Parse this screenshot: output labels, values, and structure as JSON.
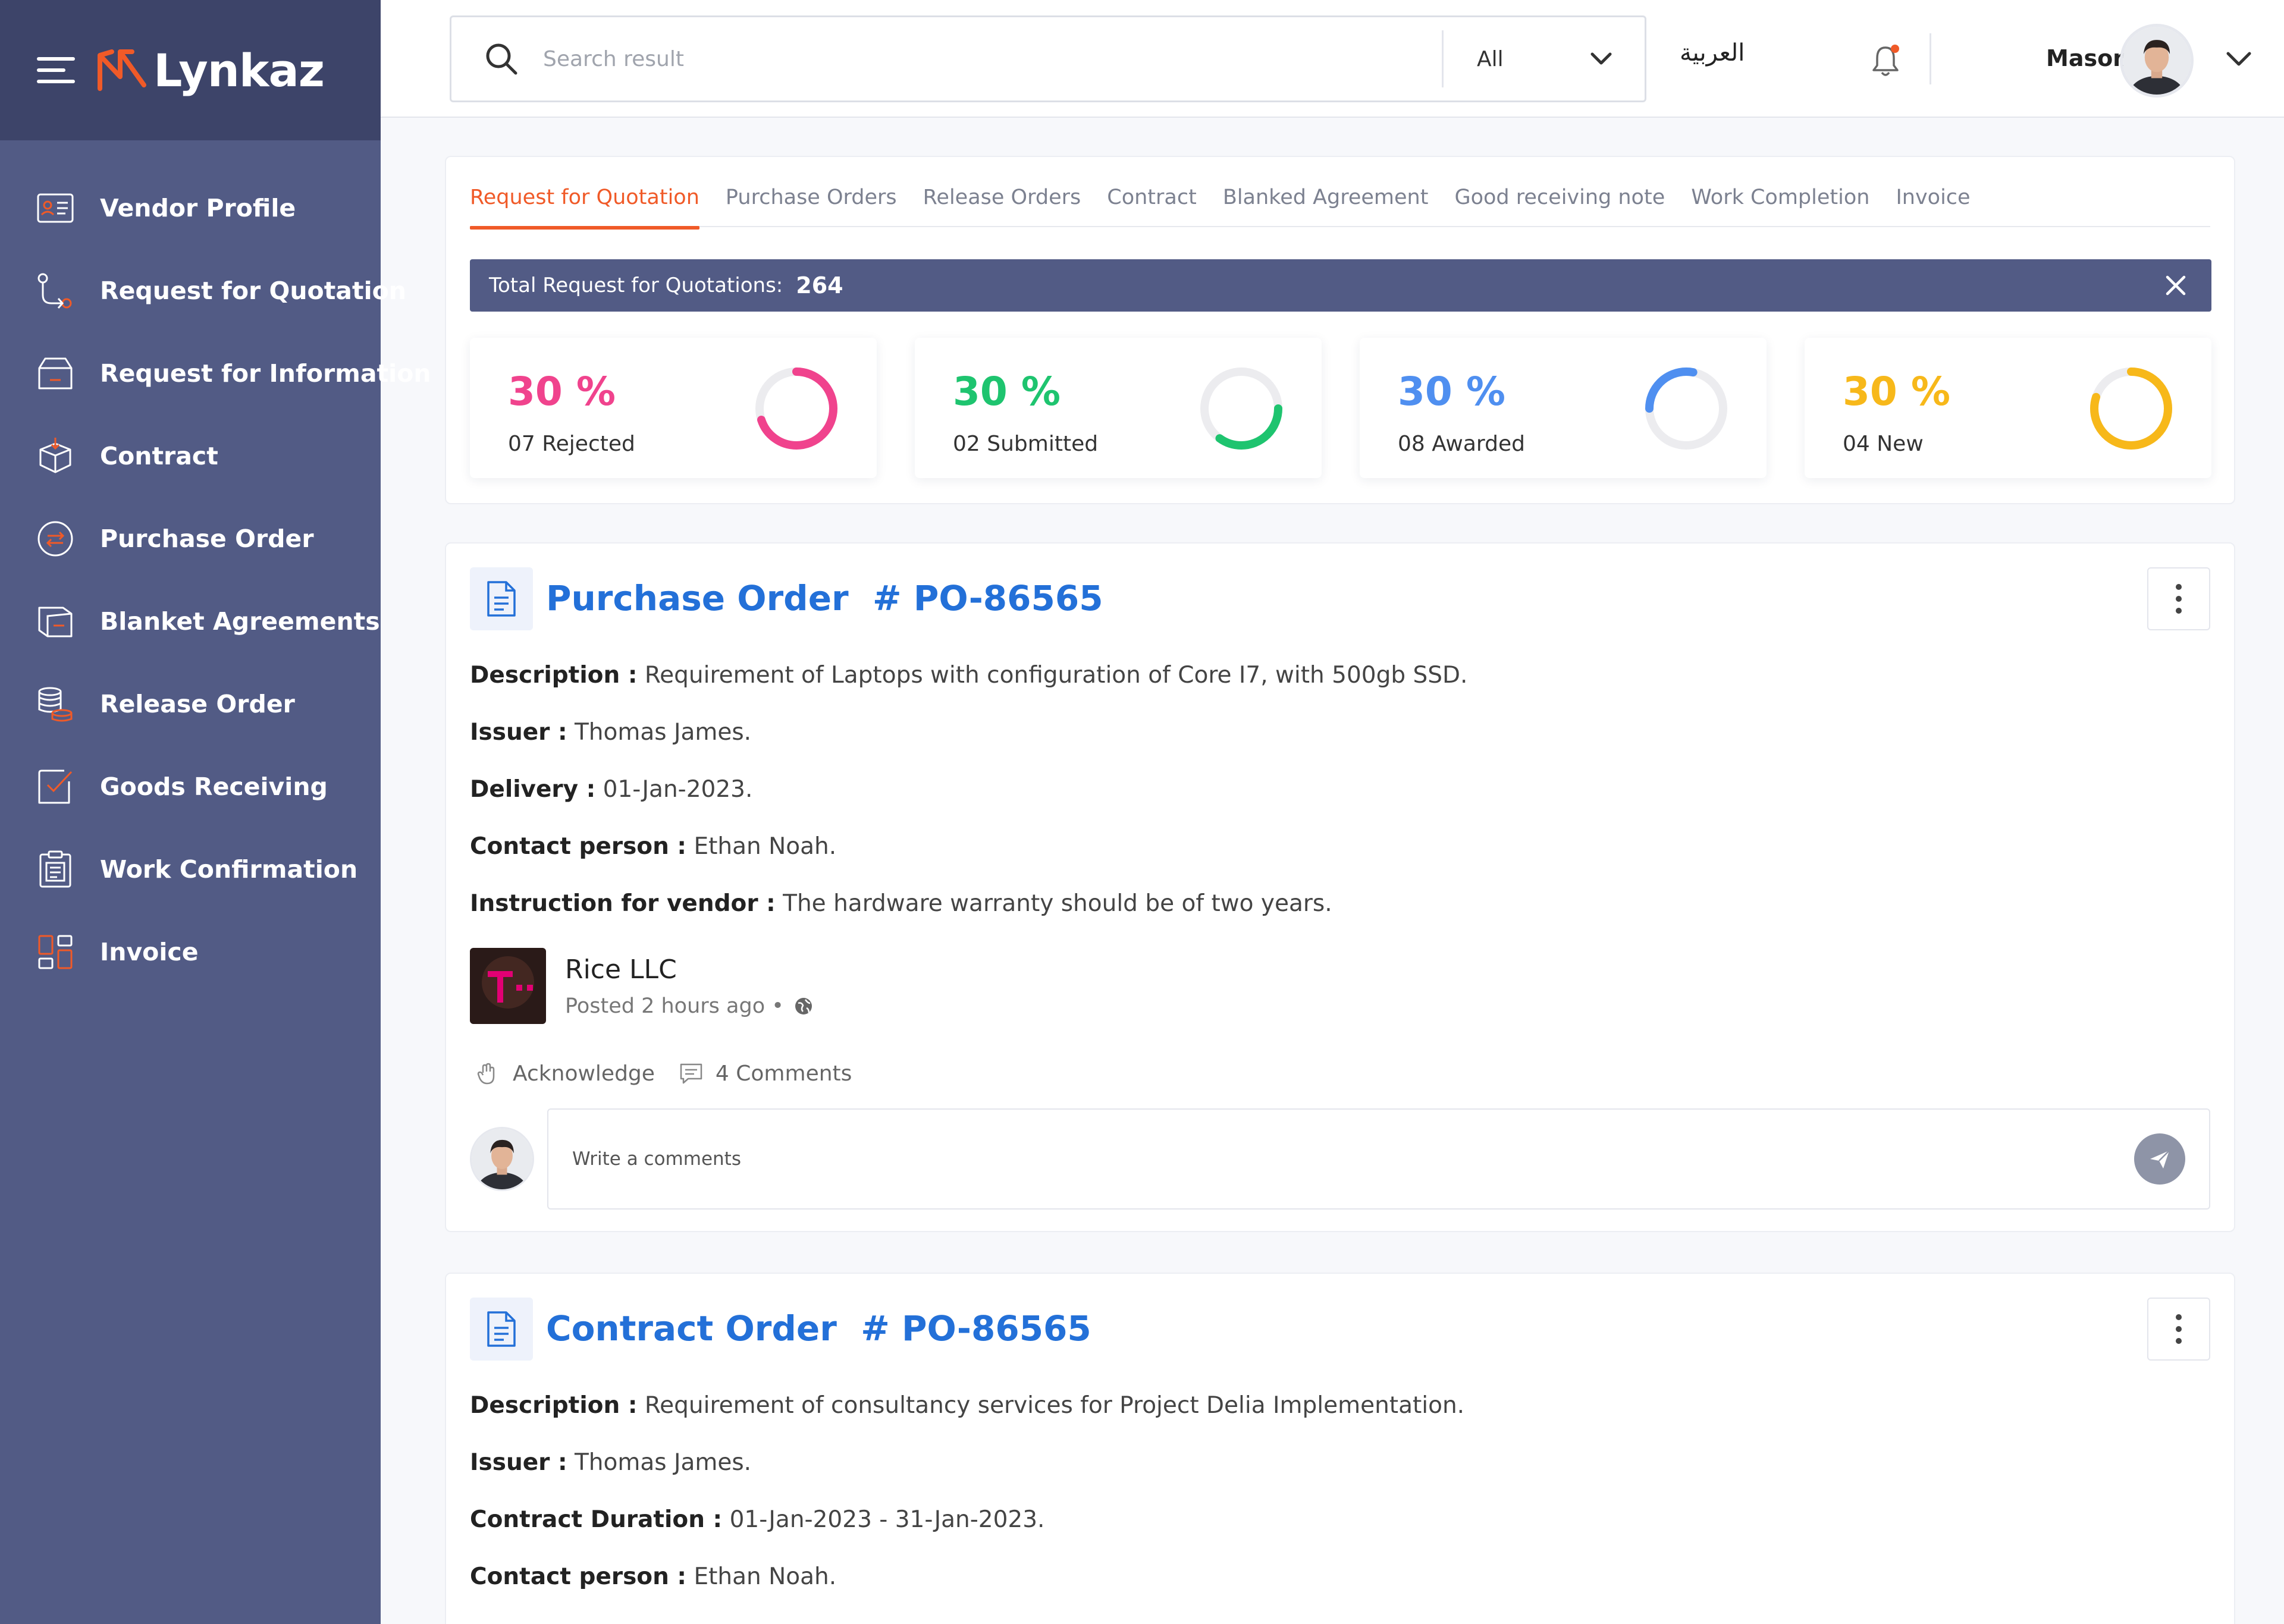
{
  "app": {
    "name": "Lynkaz",
    "accent_color": "#f05a28",
    "sidebar_color": "#525b85"
  },
  "sidebar": {
    "items": [
      {
        "label": "Vendor Profile",
        "icon": "vendor-profile-icon"
      },
      {
        "label": "Request for Quotation",
        "icon": "request-quotation-icon"
      },
      {
        "label": "Request for Information",
        "icon": "request-information-icon"
      },
      {
        "label": "Contract",
        "icon": "contract-icon"
      },
      {
        "label": "Purchase Order",
        "icon": "purchase-order-icon"
      },
      {
        "label": "Blanket Agreements",
        "icon": "blanket-agreements-icon"
      },
      {
        "label": "Release Order",
        "icon": "release-order-icon"
      },
      {
        "label": "Goods Receiving",
        "icon": "goods-receiving-icon"
      },
      {
        "label": "Work Confirmation",
        "icon": "work-confirmation-icon"
      },
      {
        "label": "Invoice",
        "icon": "invoice-icon"
      }
    ]
  },
  "header": {
    "search_placeholder": "Search result",
    "search_filter": "All",
    "language": "العربية",
    "user_name": "Mason"
  },
  "tabs": [
    {
      "label": "Request for Quotation",
      "active": true
    },
    {
      "label": "Purchase Orders",
      "active": false
    },
    {
      "label": "Release Orders",
      "active": false
    },
    {
      "label": "Contract",
      "active": false
    },
    {
      "label": "Blanked Agreement",
      "active": false
    },
    {
      "label": "Good receiving note",
      "active": false
    },
    {
      "label": "Work Completion",
      "active": false
    },
    {
      "label": "Invoice",
      "active": false
    }
  ],
  "summary": {
    "label": "Total Request for Quotations:",
    "count": "264"
  },
  "stats": [
    {
      "percent": "30 %",
      "label": "07 Rejected",
      "color": "#f0438d",
      "fraction": 0.7,
      "start": "top"
    },
    {
      "percent": "30 %",
      "label": "02 Submitted",
      "color": "#1ec46f",
      "fraction": 0.35,
      "start": "right"
    },
    {
      "percent": "30 %",
      "label": "08 Awarded",
      "color": "#4f8ff0",
      "fraction": 0.28,
      "start": "left"
    },
    {
      "percent": "30 %",
      "label": "04 New",
      "color": "#f7b81a",
      "fraction": 0.8,
      "start": "top"
    }
  ],
  "posts": [
    {
      "title_type": "Purchase Order",
      "title_number": "# PO-86565",
      "fields": [
        {
          "label": "Description :",
          "value": "Requirement of Laptops with configuration of Core I7, with 500gb SSD."
        },
        {
          "label": "Issuer :",
          "value": "Thomas James."
        },
        {
          "label": "Delivery :",
          "value": "01-Jan-2023."
        },
        {
          "label": "Contact person :",
          "value": "Ethan Noah."
        },
        {
          "label": "Instruction for vendor :",
          "value": "The hardware warranty should be of two years."
        }
      ],
      "company": {
        "name": "Rice LLC",
        "posted": "Posted 2 hours ago •"
      },
      "actions": {
        "acknowledge": "Acknowledge",
        "comments": "4 Comments"
      },
      "comment_placeholder": "Write a comments"
    },
    {
      "title_type": "Contract Order",
      "title_number": "# PO-86565",
      "fields": [
        {
          "label": "Description :",
          "value": "Requirement of consultancy services for Project Delia Implementation."
        },
        {
          "label": "Issuer :",
          "value": "Thomas James."
        },
        {
          "label": "Contract Duration :",
          "value": "01-Jan-2023 - 31-Jan-2023."
        },
        {
          "label": "Contact person :",
          "value": "Ethan Noah."
        }
      ]
    }
  ]
}
